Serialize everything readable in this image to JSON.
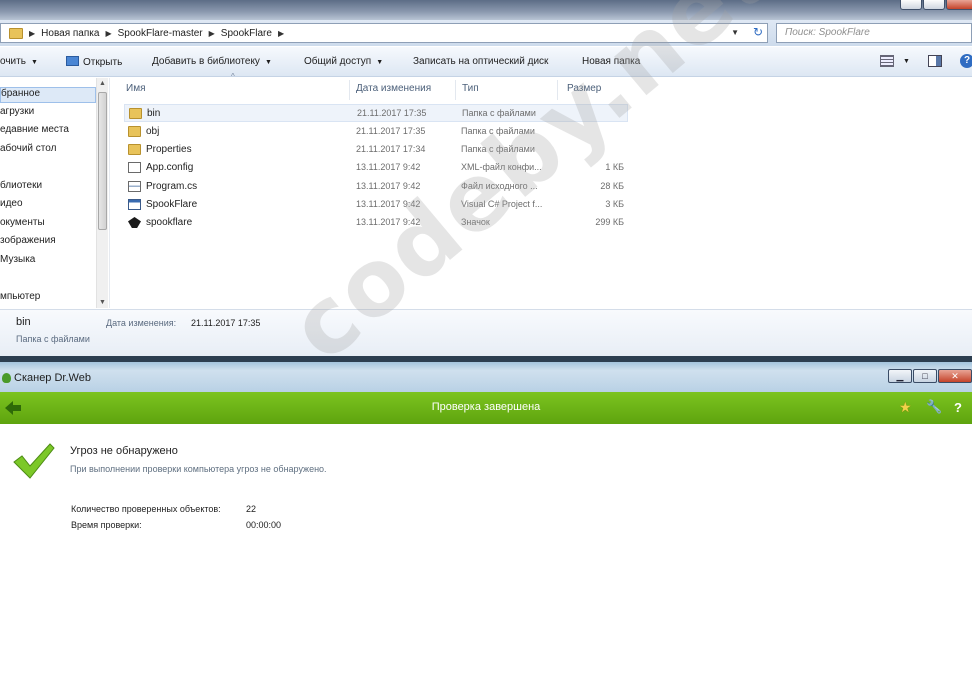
{
  "explorer": {
    "breadcrumb": [
      "Новая папка",
      "SpookFlare-master",
      "SpookFlare"
    ],
    "search_placeholder": "Поиск: SpookFlare",
    "toolbar": {
      "organize": "очить",
      "open": "Открыть",
      "add_to_library": "Добавить в библиотеку",
      "share": "Общий доступ",
      "burn": "Записать на оптический диск",
      "new_folder": "Новая папка"
    },
    "nav": [
      {
        "label": "бранное",
        "selected": true
      },
      {
        "label": "агрузки"
      },
      {
        "label": "едавние места"
      },
      {
        "label": "абочий стол"
      },
      {
        "label": "блиотеки"
      },
      {
        "label": "идео"
      },
      {
        "label": "окументы"
      },
      {
        "label": "зображения"
      },
      {
        "label": "Музыка"
      },
      {
        "label": "мпьютер"
      }
    ],
    "columns": {
      "name": "Имя",
      "date": "Дата изменения",
      "type": "Тип",
      "size": "Размер"
    },
    "files": [
      {
        "name": "bin",
        "date": "21.11.2017 17:35",
        "type": "Папка с файлами",
        "size": "",
        "icon": "folder-icon"
      },
      {
        "name": "obj",
        "date": "21.11.2017 17:35",
        "type": "Папка с файлами",
        "size": "",
        "icon": "folder-icon"
      },
      {
        "name": "Properties",
        "date": "21.11.2017 17:34",
        "type": "Папка с файлами",
        "size": "",
        "icon": "folder-icon"
      },
      {
        "name": "App.config",
        "date": "13.11.2017 9:42",
        "type": "XML-файл конфи...",
        "size": "1 КБ",
        "icon": "config-file-icon"
      },
      {
        "name": "Program.cs",
        "date": "13.11.2017 9:42",
        "type": "Файл исходного ...",
        "size": "28 КБ",
        "icon": "cs-file-icon"
      },
      {
        "name": "SpookFlare",
        "date": "13.11.2017 9:42",
        "type": "Visual C# Project f...",
        "size": "3 КБ",
        "icon": "csproj-file-icon"
      },
      {
        "name": "spookflare",
        "date": "13.11.2017 9:42",
        "type": "Значок",
        "size": "299 КБ",
        "icon": "spookflare-ico-icon"
      }
    ],
    "details": {
      "name": "bin",
      "date_label": "Дата изменения:",
      "date_value": "21.11.2017 17:35",
      "type": "Папка с файлами"
    }
  },
  "drweb": {
    "window_title": "Сканер Dr.Web",
    "bar_title": "Проверка завершена",
    "result_heading": "Угроз не обнаружено",
    "result_desc": "При выполнении проверки компьютера угроз не обнаружено.",
    "stats": [
      {
        "label": "Количество проверенных объектов:",
        "value": "22"
      },
      {
        "label": "Время проверки:",
        "value": "00:00:00"
      }
    ],
    "accent_color": "#6ab414"
  },
  "watermark": "codeby.net"
}
